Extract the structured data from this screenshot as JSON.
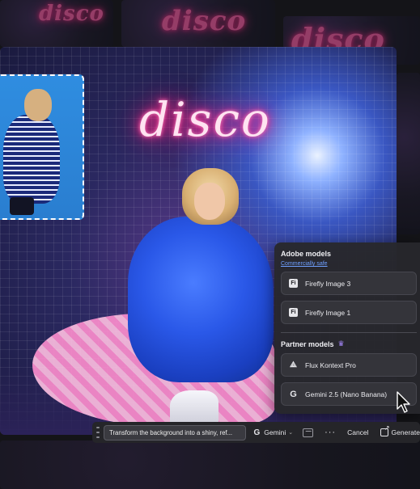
{
  "background": {
    "thumb_text": [
      "disco",
      "disco",
      "disco"
    ]
  },
  "canvas": {
    "sign_text": "disco"
  },
  "model_panel": {
    "adobe_section": {
      "title": "Adobe models",
      "subtitle": "Commercially safe",
      "items": [
        {
          "label": "Firefly Image 3",
          "icon": "firefly-icon"
        },
        {
          "label": "Firefly Image 1",
          "icon": "firefly-icon"
        }
      ]
    },
    "partner_section": {
      "title": "Partner models",
      "icon": "crown-icon",
      "items": [
        {
          "label": "Flux Kontext Pro",
          "icon": "flux-icon"
        },
        {
          "label": "Gemini 2.5 (Nano Banana)",
          "icon": "google-icon"
        }
      ]
    }
  },
  "toolbar": {
    "prompt_text": "Transform the background into a shiny, ref...",
    "model_label": "Gemini",
    "cancel_label": "Cancel",
    "generate_label": "Generate"
  },
  "colors": {
    "accent_link": "#6fa0ff",
    "neon_pink": "#ff2d8a",
    "panel_bg": "#28282c"
  }
}
